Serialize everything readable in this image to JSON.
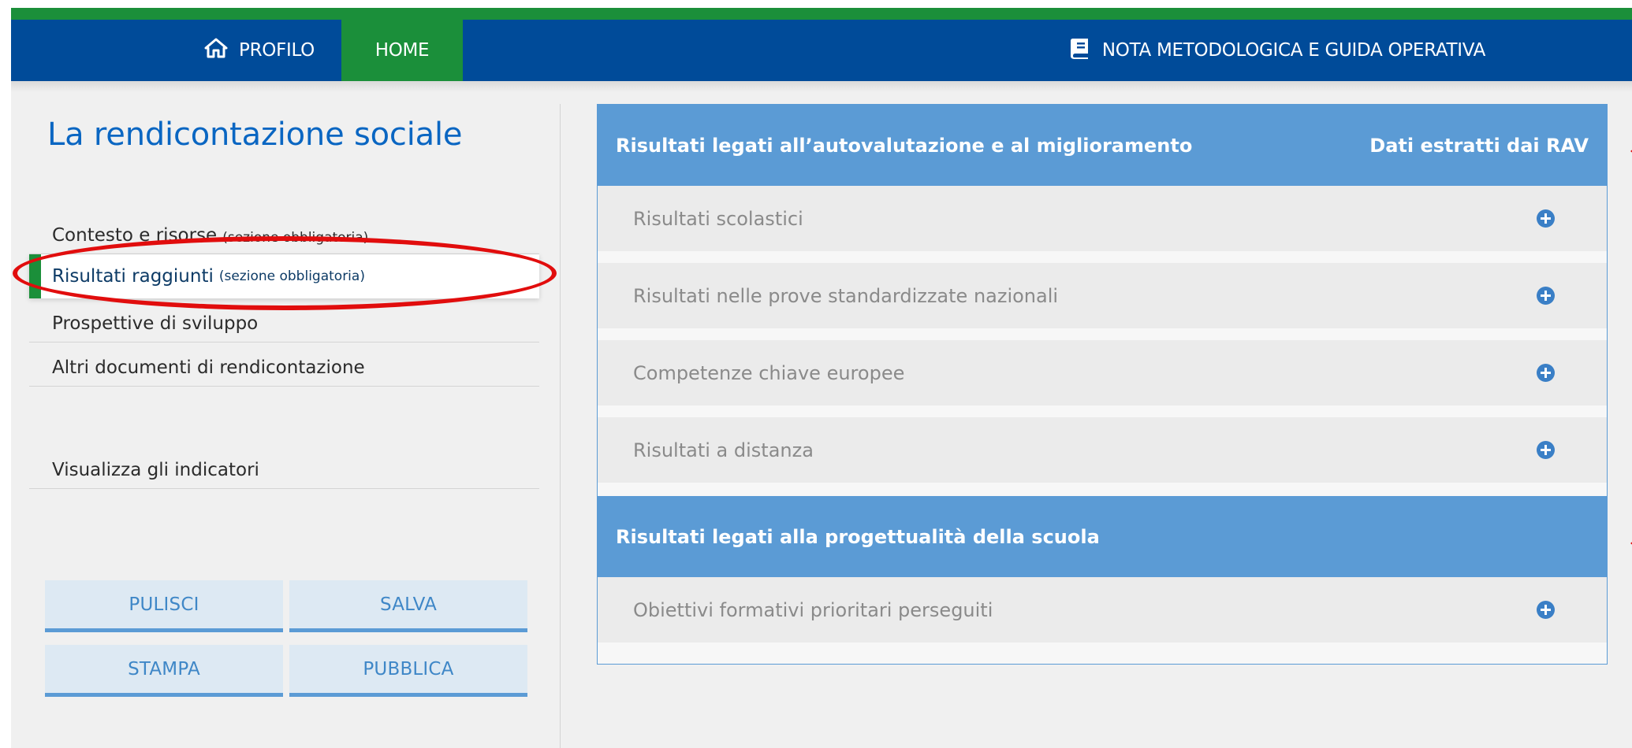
{
  "nav": {
    "profilo": "PROFILO",
    "home": "HOME",
    "nota": "NOTA METODOLOGICA E GUIDA OPERATIVA"
  },
  "sidebar": {
    "title": "La rendicontazione sociale",
    "items": [
      {
        "label": "Contesto e risorse",
        "note": "(sezione obbligatoria)"
      },
      {
        "label": "Risultati raggiunti",
        "note": "(sezione obbligatoria)"
      },
      {
        "label": "Prospettive di sviluppo"
      },
      {
        "label": "Altri documenti di rendicontazione"
      },
      {
        "label": "Visualizza gli indicatori"
      }
    ],
    "active_index": 1
  },
  "buttons": {
    "pulisci": "PULISCI",
    "salva": "SALVA",
    "stampa": "STAMPA",
    "pubblica": "PUBBLICA"
  },
  "main": {
    "section1": {
      "title": "Risultati legati all’autovalutazione e al miglioramento",
      "right_label": "Dati estratti dai RAV",
      "rows": [
        "Risultati scolastici",
        "Risultati nelle prove standardizzate nazionali",
        "Competenze chiave europee",
        "Risultati a distanza"
      ]
    },
    "section2": {
      "title": "Risultati legati alla progettualità della scuola",
      "rows": [
        "Obiettivi formativi prioritari perseguiti"
      ]
    }
  },
  "colors": {
    "nav_blue": "#004b99",
    "accent_green": "#1b8f3a",
    "section_blue": "#5b9bd5",
    "annotation_red": "#e10d0d"
  },
  "icons": {
    "profilo": "home-icon",
    "nota": "book-icon",
    "row_expand": "plus-circle-icon"
  }
}
